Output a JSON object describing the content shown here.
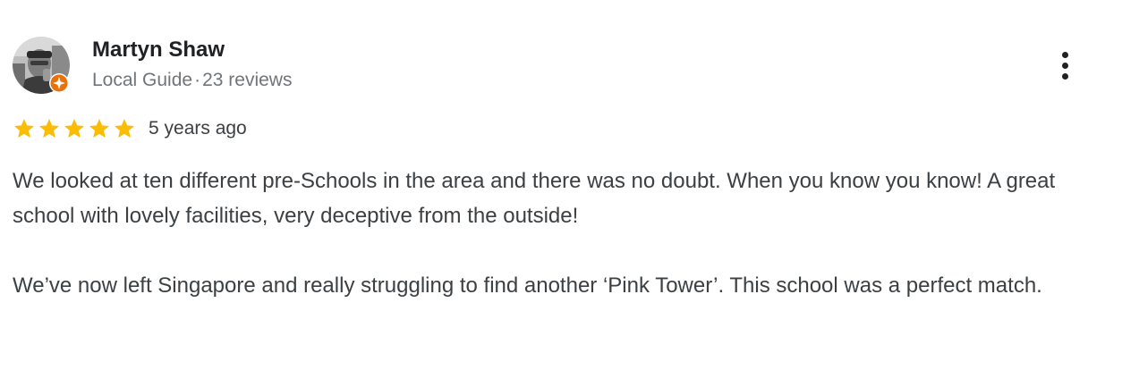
{
  "reviewer": {
    "name": "Martyn Shaw",
    "role": "Local Guide",
    "separator": "·",
    "review_count": "23 reviews",
    "avatar_icon": "reviewer-photo",
    "badge_icon": "local-guide-badge-icon",
    "badge_color": "#e8710a"
  },
  "rating": {
    "stars": 5,
    "max": 5,
    "star_color": "#fbbc04"
  },
  "date": "5 years ago",
  "menu_icon": "more-vert-icon",
  "review": {
    "paragraphs": [
      "We looked at ten different pre-Schools in the area and there was no doubt. When you know you know! A great school with lovely facilities, very deceptive from the outside!",
      "We’ve now left Singapore and really struggling to find another ‘Pink Tower’. This school was a perfect match."
    ]
  }
}
